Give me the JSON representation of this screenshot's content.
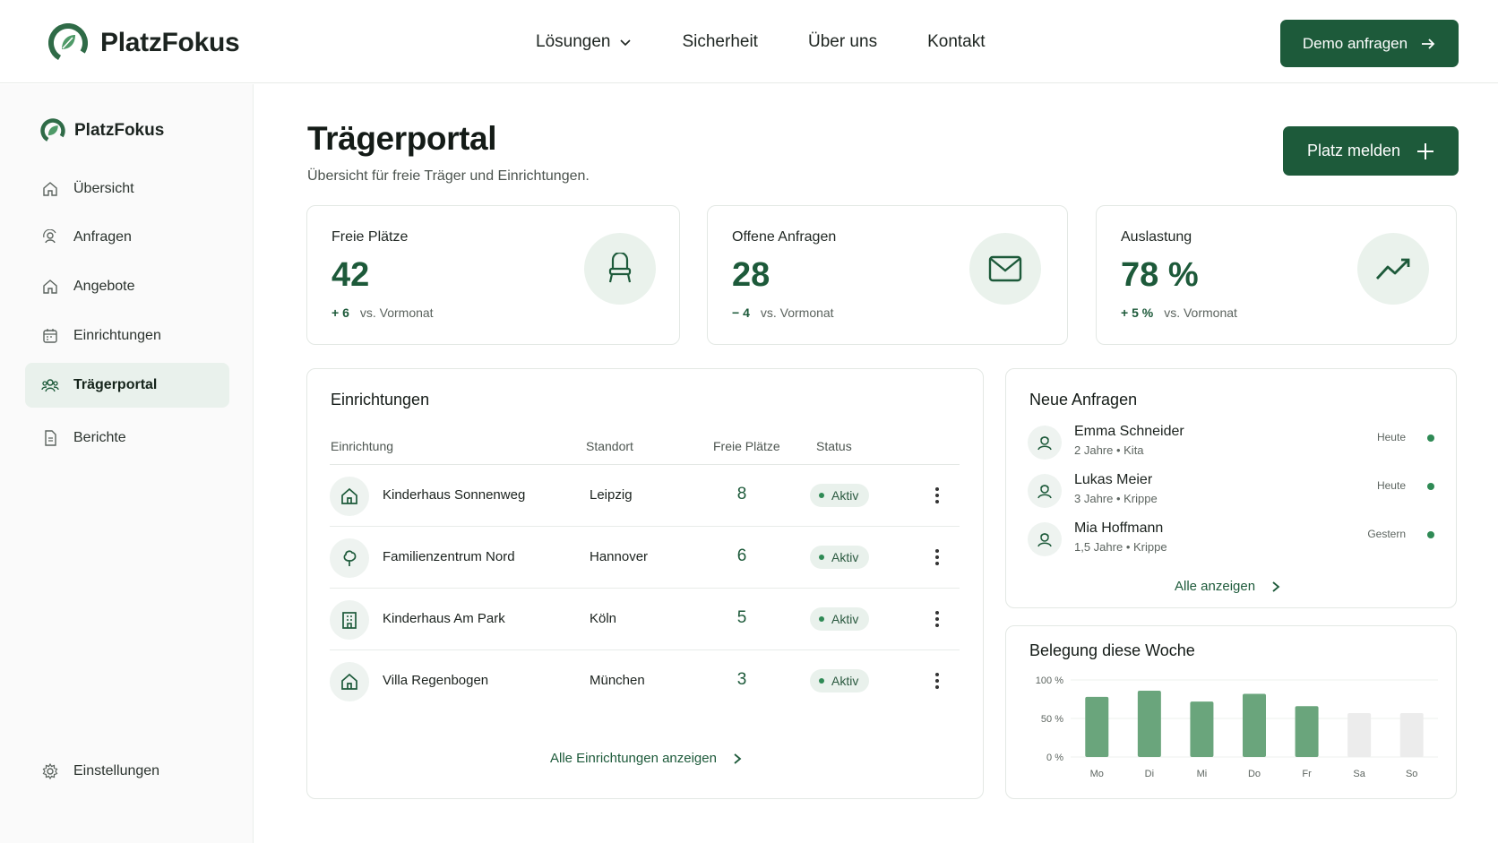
{
  "brand": {
    "name": "PlatzFokus"
  },
  "nav": {
    "items": [
      {
        "label": "Lösungen",
        "has_dropdown": true
      },
      {
        "label": "Sicherheit"
      },
      {
        "label": "Über uns"
      },
      {
        "label": "Kontakt"
      }
    ],
    "cta_label": "Demo anfragen"
  },
  "sidebar": {
    "brand": "PlatzFokus",
    "items": [
      {
        "label": "Übersicht",
        "icon": "home-icon"
      },
      {
        "label": "Anfragen",
        "icon": "refresh-user-icon"
      },
      {
        "label": "Angebote",
        "icon": "home-icon"
      },
      {
        "label": "Einrichtungen",
        "icon": "calendar-icon"
      },
      {
        "label": "Trägerportal",
        "icon": "users-icon",
        "active": true
      },
      {
        "label": "Berichte",
        "icon": "document-icon"
      }
    ],
    "settings_label": "Einstellungen"
  },
  "header": {
    "title": "Trägerportal",
    "subtitle": "Übersicht für freie Träger und Einrichtungen.",
    "action_label": "Platz melden"
  },
  "stats": [
    {
      "label": "Freie Plätze",
      "value": "42",
      "delta": "+ 6",
      "delta_note": "vs. Vormonat",
      "icon": "chair-icon"
    },
    {
      "label": "Offene Anfragen",
      "value": "28",
      "delta": "− 4",
      "delta_note": "vs. Vormonat",
      "icon": "mail-icon"
    },
    {
      "label": "Auslastung",
      "value": "78 %",
      "delta": "+ 5 %",
      "delta_note": "vs. Vormonat",
      "icon": "trend-up-icon"
    }
  ],
  "facilities": {
    "title": "Einrichtungen",
    "columns": [
      "Einrichtung",
      "Standort",
      "Freie Plätze",
      "Status"
    ],
    "rows": [
      {
        "name": "Kinderhaus Sonnenweg",
        "city": "Leipzig",
        "free": "8",
        "status": "Aktiv",
        "icon": "house-icon"
      },
      {
        "name": "Familienzentrum Nord",
        "city": "Hannover",
        "free": "6",
        "status": "Aktiv",
        "icon": "tree-icon"
      },
      {
        "name": "Kinderhaus Am Park",
        "city": "Köln",
        "free": "5",
        "status": "Aktiv",
        "icon": "building-icon"
      },
      {
        "name": "Villa Regenbogen",
        "city": "München",
        "free": "3",
        "status": "Aktiv",
        "icon": "house-icon"
      }
    ],
    "show_all": "Alle Einrichtungen anzeigen"
  },
  "requests": {
    "title": "Neue Anfragen",
    "items": [
      {
        "name": "Emma Schneider",
        "meta": "2 Jahre • Kita",
        "when": "Heute"
      },
      {
        "name": "Lukas Meier",
        "meta": "3 Jahre • Krippe",
        "when": "Heute"
      },
      {
        "name": "Mia Hoffmann",
        "meta": "1,5 Jahre  • Krippe",
        "when": "Gestern"
      }
    ],
    "show_all": "Alle anzeigen"
  },
  "chart_data": {
    "type": "bar",
    "title": "Belegung diese Woche",
    "categories": [
      "Mo",
      "Di",
      "Mi",
      "Do",
      "Fr",
      "Sa",
      "So"
    ],
    "values": [
      78,
      86,
      72,
      82,
      66,
      57,
      57
    ],
    "y_ticks": [
      "100 %",
      "50 %",
      "0 %"
    ],
    "ylim": [
      0,
      100
    ],
    "colors": {
      "weekday": "#6aa57c",
      "weekend": "#ececec"
    },
    "grid": true
  }
}
